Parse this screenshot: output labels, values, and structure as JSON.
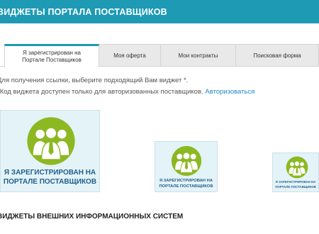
{
  "header": {
    "title": "ВИДЖЕТЫ ПОРТАЛА ПОСТАВЩИКОВ"
  },
  "tabs": [
    {
      "label_line1": "Я зарегистрирован на",
      "label_line2": "Портале Поставщиков",
      "active": true
    },
    {
      "label": "Моя оферта",
      "active": false
    },
    {
      "label": "Мои контракты",
      "active": false
    },
    {
      "label": "Поисковая форма",
      "active": false
    }
  ],
  "info": {
    "line1": "Для получения ссылки, выберите подходящий Вам виджет *.",
    "line2": "*Код виджета доступен только для авторизованных поставщиков.",
    "login_link": "Авторизоваться"
  },
  "widget": {
    "line1": "Я ЗАРЕГИСТРИРОВАН НА",
    "line2": "ПОРТАЛЕ ПОСТАВЩИКОВ",
    "circle_color": "#8cb822",
    "text_color": "#1f5f8b",
    "bg_color": "#e4f3f8"
  },
  "external": {
    "title": "ВИДЖЕТЫ ВНЕШНИХ ИНФОРМАЦИОННЫХ СИСТЕМ"
  },
  "colors": {
    "header": "#1e9ab5",
    "link": "#1e8cc4"
  }
}
